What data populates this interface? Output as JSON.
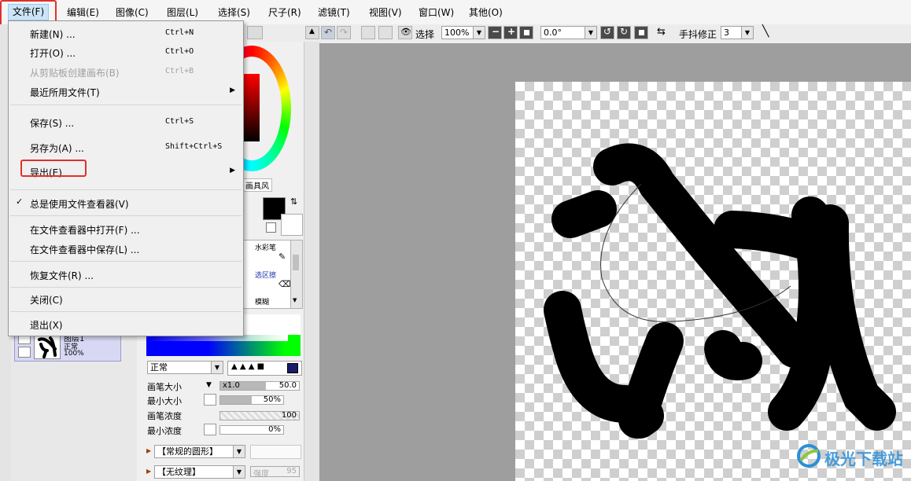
{
  "menubar": {
    "items": [
      "文件(F)",
      "编辑(E)",
      "图像(C)",
      "图层(L)",
      "选择(S)",
      "尺子(R)",
      "滤镜(T)",
      "视图(V)",
      "窗口(W)",
      "其他(O)"
    ]
  },
  "toolbar": {
    "select_label": "选择",
    "zoom": "100%",
    "angle": "0.0°",
    "stabilizer_label": "手抖修正",
    "stabilizer_value": "3"
  },
  "file_menu": {
    "items": [
      {
        "label": "新建(N) ...",
        "shortcut": "Ctrl+N"
      },
      {
        "label": "打开(O) ...",
        "shortcut": "Ctrl+O"
      },
      {
        "label": "从剪贴板创建画布(B)",
        "shortcut": "Ctrl+B"
      },
      {
        "label": "最近所用文件(T)",
        "shortcut": ""
      },
      {
        "label": "保存(S) ...",
        "shortcut": "Ctrl+S"
      },
      {
        "label": "另存为(A) ...",
        "shortcut": "Shift+Ctrl+S"
      },
      {
        "label": "导出(E)",
        "shortcut": ""
      },
      {
        "label": "总是使用文件查看器(V)",
        "shortcut": ""
      },
      {
        "label": "在文件查看器中打开(F) ...",
        "shortcut": ""
      },
      {
        "label": "在文件查看器中保存(L) ...",
        "shortcut": ""
      },
      {
        "label": "恢复文件(R) ...",
        "shortcut": ""
      },
      {
        "label": "关闭(C)",
        "shortcut": ""
      },
      {
        "label": "退出(X)",
        "shortcut": ""
      }
    ]
  },
  "color_panel": {
    "tab_label": "画具风"
  },
  "tools": {
    "watercolor": "水彩笔",
    "select_eraser": "选区擦",
    "blur": "模糊"
  },
  "layer": {
    "name": "图层1",
    "mode": "正常",
    "opacity": "100%"
  },
  "brush": {
    "blend_mode": "正常",
    "size_label": "画笔大小",
    "size_multiplier": "x1.0",
    "size_value": "50.0",
    "min_size_label": "最小大小",
    "min_size_value": "50%",
    "density_label": "画笔浓度",
    "density_value": "100",
    "min_density_label": "最小浓度",
    "min_density_value": "0%",
    "shape_label": "【常规的圆形】",
    "texture_label": "【无纹理】",
    "strength_label": "强度",
    "strength_value": "95"
  },
  "watermark": {
    "text": "极光下载站"
  },
  "colors": {
    "highlight_red": "#e0302c",
    "menu_hover": "#cce4f7",
    "canvas_bg": "#9e9e9e"
  }
}
